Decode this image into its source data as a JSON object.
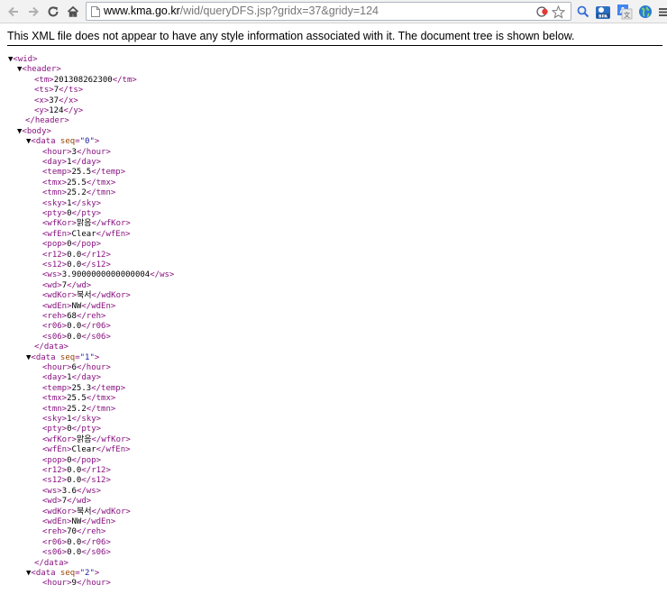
{
  "browser": {
    "url_host": "www.kma.go.kr",
    "url_path": "/wid/queryDFS.jsp?gridx=37&gridy=124"
  },
  "info_message": "This XML file does not appear to have any style information associated with it. The document tree is shown below.",
  "root_tag": "wid",
  "header": {
    "tag": "header",
    "fields": [
      {
        "tag": "tm",
        "value": "201308262300"
      },
      {
        "tag": "ts",
        "value": "7"
      },
      {
        "tag": "x",
        "value": "37"
      },
      {
        "tag": "y",
        "value": "124"
      }
    ]
  },
  "body_tag": "body",
  "data_tag": "data",
  "data_attr": "seq",
  "data_items": [
    {
      "seq": "0",
      "fields": [
        {
          "tag": "hour",
          "value": "3"
        },
        {
          "tag": "day",
          "value": "1"
        },
        {
          "tag": "temp",
          "value": "25.5"
        },
        {
          "tag": "tmx",
          "value": "25.5"
        },
        {
          "tag": "tmn",
          "value": "25.2"
        },
        {
          "tag": "sky",
          "value": "1"
        },
        {
          "tag": "pty",
          "value": "0"
        },
        {
          "tag": "wfKor",
          "value": "맑음"
        },
        {
          "tag": "wfEn",
          "value": "Clear"
        },
        {
          "tag": "pop",
          "value": "0"
        },
        {
          "tag": "r12",
          "value": "0.0"
        },
        {
          "tag": "s12",
          "value": "0.0"
        },
        {
          "tag": "ws",
          "value": "3.9000000000000004"
        },
        {
          "tag": "wd",
          "value": "7"
        },
        {
          "tag": "wdKor",
          "value": "북서"
        },
        {
          "tag": "wdEn",
          "value": "NW"
        },
        {
          "tag": "reh",
          "value": "68"
        },
        {
          "tag": "r06",
          "value": "0.0"
        },
        {
          "tag": "s06",
          "value": "0.0"
        }
      ]
    },
    {
      "seq": "1",
      "fields": [
        {
          "tag": "hour",
          "value": "6"
        },
        {
          "tag": "day",
          "value": "1"
        },
        {
          "tag": "temp",
          "value": "25.3"
        },
        {
          "tag": "tmx",
          "value": "25.5"
        },
        {
          "tag": "tmn",
          "value": "25.2"
        },
        {
          "tag": "sky",
          "value": "1"
        },
        {
          "tag": "pty",
          "value": "0"
        },
        {
          "tag": "wfKor",
          "value": "맑음"
        },
        {
          "tag": "wfEn",
          "value": "Clear"
        },
        {
          "tag": "pop",
          "value": "0"
        },
        {
          "tag": "r12",
          "value": "0.0"
        },
        {
          "tag": "s12",
          "value": "0.0"
        },
        {
          "tag": "ws",
          "value": "3.6"
        },
        {
          "tag": "wd",
          "value": "7"
        },
        {
          "tag": "wdKor",
          "value": "북서"
        },
        {
          "tag": "wdEn",
          "value": "NW"
        },
        {
          "tag": "reh",
          "value": "70"
        },
        {
          "tag": "r06",
          "value": "0.0"
        },
        {
          "tag": "s06",
          "value": "0.0"
        }
      ]
    },
    {
      "seq": "2",
      "fields": [
        {
          "tag": "hour",
          "value": "9"
        }
      ]
    }
  ]
}
